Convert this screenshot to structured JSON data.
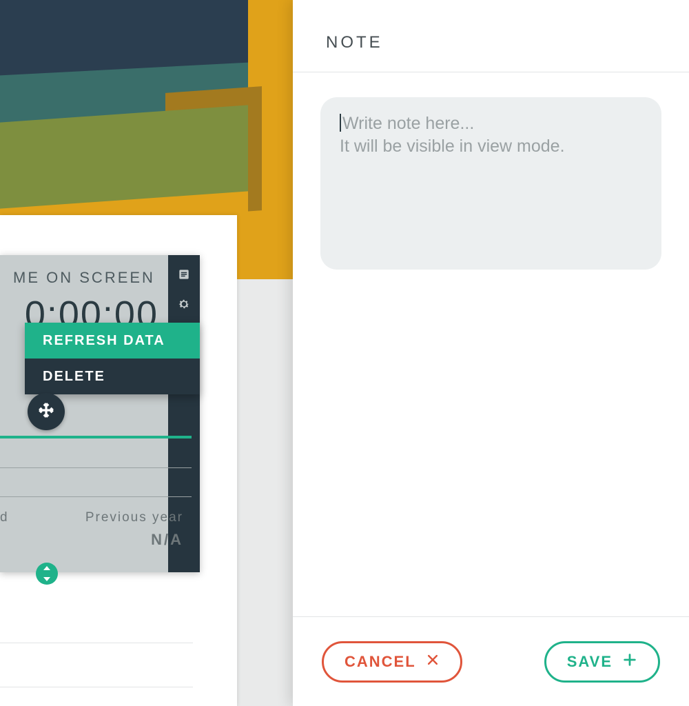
{
  "panel": {
    "title": "NOTE",
    "placeholder": "Write note here...\nIt will be visible in view mode.",
    "cancel_label": "CANCEL",
    "save_label": "SAVE"
  },
  "widget": {
    "title_fragment": "ME ON SCREEN",
    "value_fragment": "0:00:00",
    "menu": {
      "refresh": "REFRESH DATA",
      "delete": "DELETE"
    },
    "prev_year_label": "Previous year",
    "prev_year_value": "N/A",
    "left_fragment": "d"
  },
  "icons": {
    "note": "note-icon",
    "gear": "gear-icon",
    "move": "move-icon",
    "close": "close-icon",
    "plus": "plus-icon",
    "resize": "resize-icon"
  },
  "colors": {
    "accent": "#1fb28a",
    "danger": "#e0553b",
    "panel_bg": "#ffffff",
    "card_bg": "#c7cdce",
    "dark": "#26353f"
  }
}
